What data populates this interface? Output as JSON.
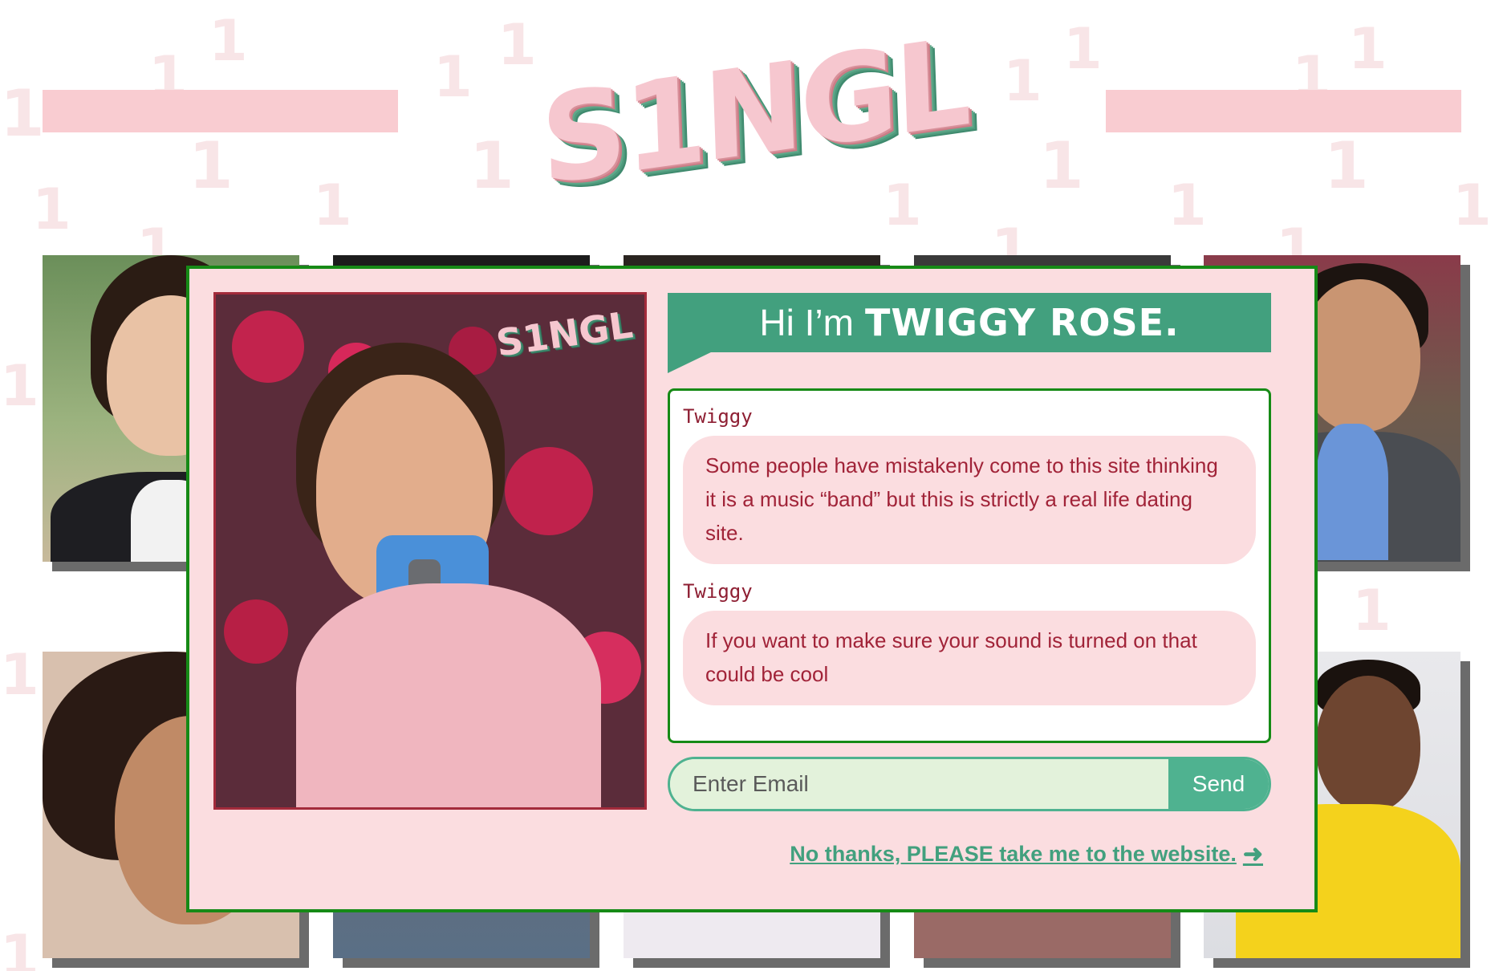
{
  "header": {
    "logo_text": "S1NGL"
  },
  "background_glyph": "1",
  "modal": {
    "photo_logo": "S1NGL",
    "title_prefix": "Hi I’m",
    "title_name": "TWIGGY ROSE.",
    "messages": [
      {
        "author": "Twiggy",
        "text": "Some people have mistakenly come to this site thinking it is a music “band” but this is strictly a real life dating site."
      },
      {
        "author": "Twiggy",
        "text": "If you want to make sure your sound is turned on that could be cool"
      }
    ],
    "email_placeholder": "Enter Email",
    "send_label": "Send",
    "skip_link": "No thanks, PLEASE take me to the website.",
    "skip_icon": "arrow-right-icon"
  },
  "colors": {
    "accent_green": "#42a07e",
    "border_green": "#168a16",
    "pink_bg": "#fbdde0",
    "pink_bar": "#f9ccd1",
    "text_red": "#a12338"
  }
}
